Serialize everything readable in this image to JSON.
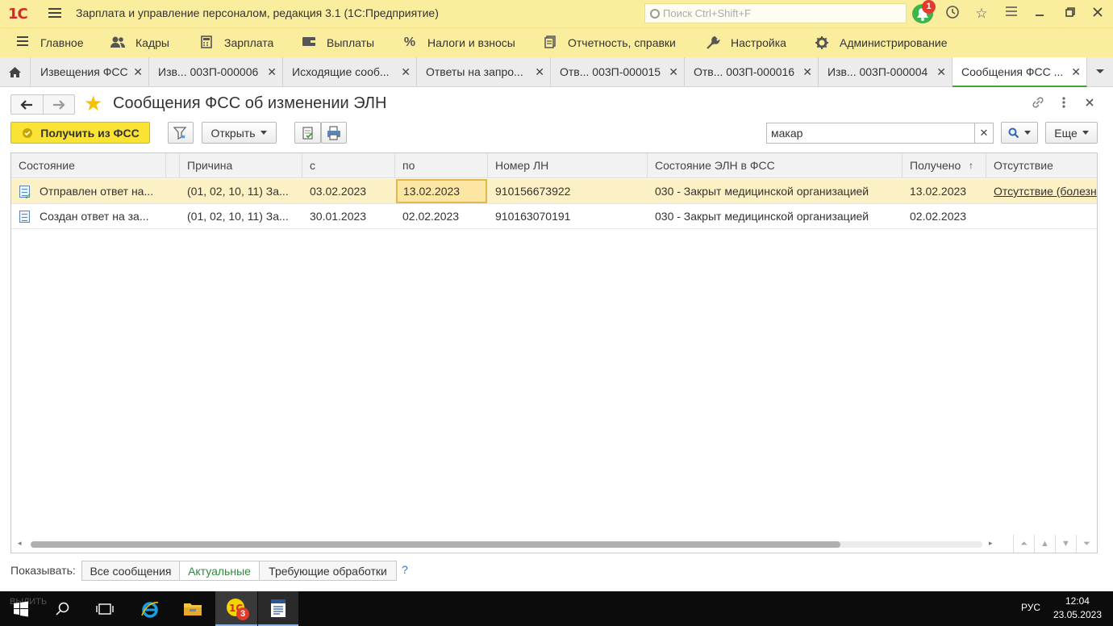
{
  "window": {
    "app_title": "Зарплата и управление персоналом, редакция 3.1  (1С:Предприятие)",
    "logo_text": "1С",
    "search_placeholder": "Поиск Ctrl+Shift+F",
    "notification_count": "1"
  },
  "sections": [
    {
      "label": "Главное",
      "icon": "menu-icon"
    },
    {
      "label": "Кадры",
      "icon": "people-icon"
    },
    {
      "label": "Зарплата",
      "icon": "calculator-icon"
    },
    {
      "label": "Выплаты",
      "icon": "wallet-icon"
    },
    {
      "label": "Налоги и взносы",
      "icon": "percent-icon"
    },
    {
      "label": "Отчетность, справки",
      "icon": "report-icon"
    },
    {
      "label": "Настройка",
      "icon": "wrench-icon"
    },
    {
      "label": "Администрирование",
      "icon": "gear-icon"
    }
  ],
  "tabs": [
    {
      "label": "Извещения ФСС"
    },
    {
      "label": "Изв... 003П-000006"
    },
    {
      "label": "Исходящие сооб..."
    },
    {
      "label": "Ответы на запро..."
    },
    {
      "label": "Отв... 003П-000015"
    },
    {
      "label": "Отв... 003П-000016"
    },
    {
      "label": "Изв... 003П-000004"
    },
    {
      "label": "Сообщения ФСС ..."
    }
  ],
  "form": {
    "title": "Сообщения ФСС об изменении ЭЛН",
    "get_button": "Получить из ФСС",
    "open_button": "Открыть",
    "search_value": "макар",
    "more_button": "Еще"
  },
  "table": {
    "columns": [
      "Состояние",
      "Причина",
      "с",
      "по",
      "Номер ЛН",
      "Состояние ЭЛН в ФСС",
      "Получено",
      "Отсутствие"
    ],
    "sort_indicator": "↑",
    "rows": [
      {
        "state": "Отправлен ответ на...",
        "reason": "(01, 02, 10, 11) За...",
        "from": "03.02.2023",
        "to": "13.02.2023",
        "number": "910156673922",
        "fss_state": "030 - Закрыт медицинской организацией",
        "received": "13.02.2023",
        "absence": "Отсутствие (болезн"
      },
      {
        "state": "Создан ответ на за...",
        "reason": "(01, 02, 10, 11) За...",
        "from": "30.01.2023",
        "to": "02.02.2023",
        "number": "910163070191",
        "fss_state": "030 - Закрыт медицинской организацией",
        "received": "02.02.2023",
        "absence": ""
      }
    ]
  },
  "filter": {
    "label": "Показывать:",
    "options": [
      "Все сообщения",
      "Актуальные",
      "Требующие обработки"
    ],
    "active": "Актуальные",
    "help": "?"
  },
  "taskbar": {
    "ghost_text": "ВЫЛИТЬ",
    "app_badge": "3",
    "lang": "РУС",
    "time": "12:04",
    "date": "23.05.2023"
  },
  "colors": {
    "accent_yellow": "#fbed9e",
    "primary_button": "#fbe336",
    "selected_row": "#fcf1c4",
    "active_tab_underline": "#4b9d42",
    "notification_green": "#3db54a"
  }
}
